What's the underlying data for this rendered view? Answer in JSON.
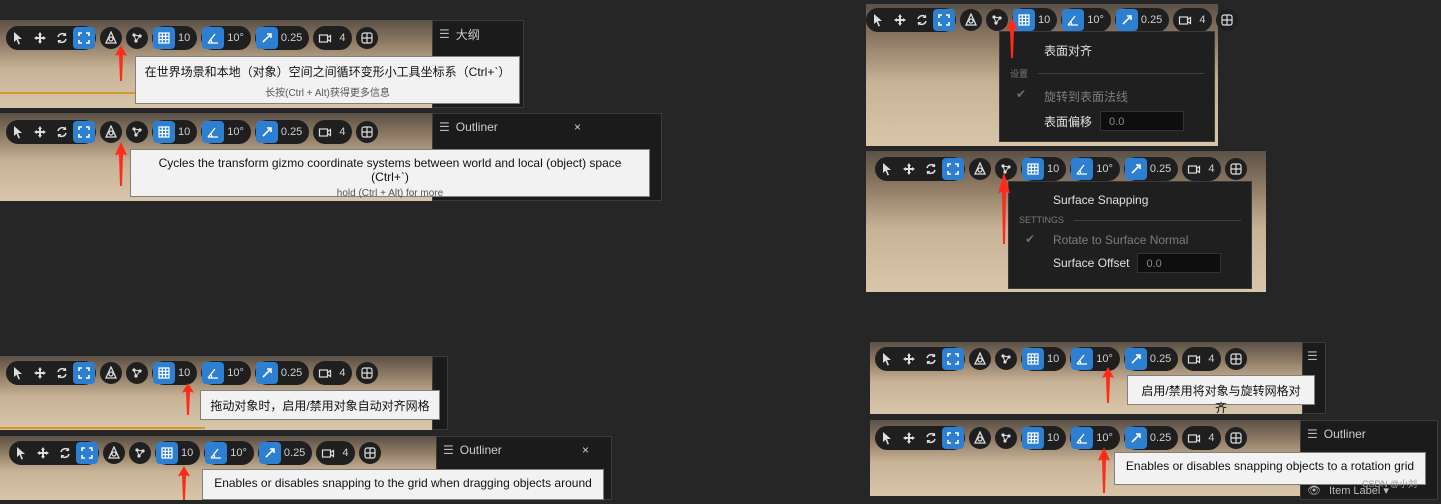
{
  "toolbar": {
    "grid_value": "10",
    "rot_value": "10°",
    "scale_value": "0.25",
    "camera_value": "4"
  },
  "icons": [
    "select-arrow-icon",
    "translate-icon",
    "rotate-icon",
    "scale-icon",
    "coord-system-icon",
    "surface-snap-icon",
    "grid-snap-icon",
    "rotation-snap-icon",
    "scale-snap-icon",
    "camera-speed-icon",
    "viewport-layout-icon"
  ],
  "panels": {
    "outliner_cn": "大纲",
    "outliner_en": "Outliner",
    "close": "×",
    "item_label": "Item Label ▾"
  },
  "tooltips": {
    "coord_cn_main": "在世界场景和本地（对象）空间之间循环变形小工具坐标系（Ctrl+`）",
    "coord_cn_sub": "长按(Ctrl + Alt)获得更多信息",
    "coord_en_main": "Cycles the transform gizmo coordinate systems between world and local (object) space (Ctrl+`)",
    "coord_en_sub": "hold (Ctrl + Alt) for more",
    "grid_cn": "拖动对象时，启用/禁用对象自动对齐网格",
    "grid_en": "Enables or disables snapping to the grid when dragging objects around",
    "rot_cn": "启用/禁用将对象与旋转网格对齐",
    "rot_en": "Enables or disables snapping objects to a rotation grid"
  },
  "surface_menu_cn": {
    "title": "表面对齐",
    "section": "设置",
    "rotate": "旋转到表面法线",
    "offset_label": "表面偏移",
    "offset_value": "0.0"
  },
  "surface_menu_en": {
    "title": "Surface Snapping",
    "section": "SETTINGS",
    "rotate": "Rotate to Surface Normal",
    "offset_label": "Surface Offset",
    "offset_value": "0.0"
  },
  "watermark": "CSDN @小刘",
  "colors": {
    "accent": "#2d7fd2",
    "arrow": "#ff2a1a",
    "tooltip_bg": "#f2f2f2"
  }
}
